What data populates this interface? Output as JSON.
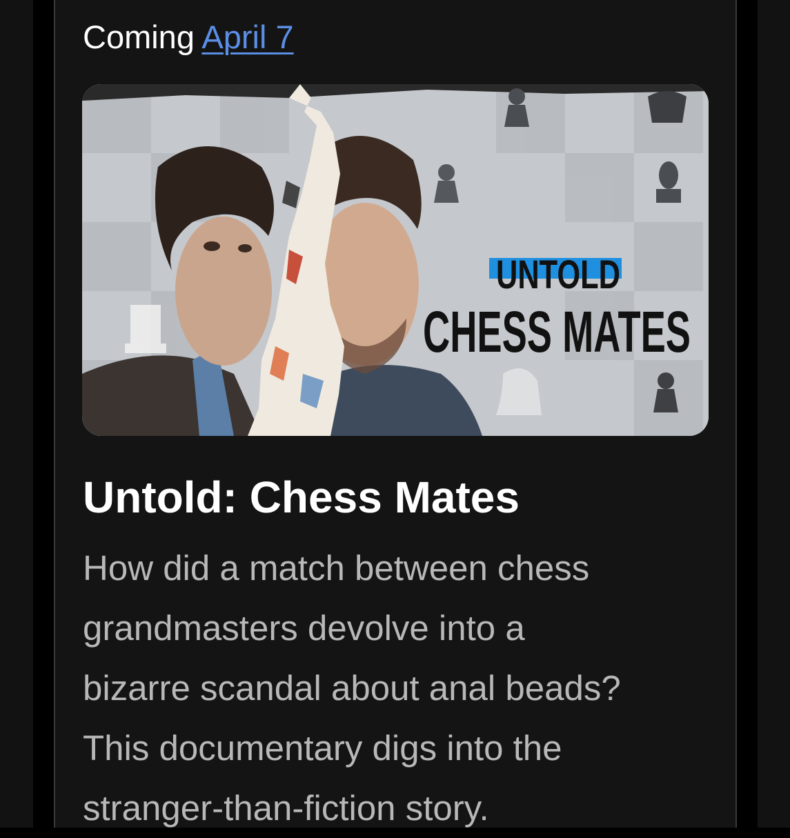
{
  "header": {
    "coming_prefix": "Coming",
    "date_link": "April 7"
  },
  "poster": {
    "title_line1": "UNTOLD",
    "title_line2": "CHESS MATES",
    "accent_color": "#1f8fe0"
  },
  "show": {
    "title": "Untold: Chess Mates",
    "description_lines": [
      "How did a match between chess",
      "grandmasters devolve into a",
      "bizarre scandal about anal beads?",
      "This documentary digs into the",
      "stranger-than-fiction story."
    ]
  },
  "colors": {
    "background": "#141414",
    "link": "#5b8fe6",
    "title_text": "#ffffff",
    "body_text": "#b8b8b8"
  }
}
